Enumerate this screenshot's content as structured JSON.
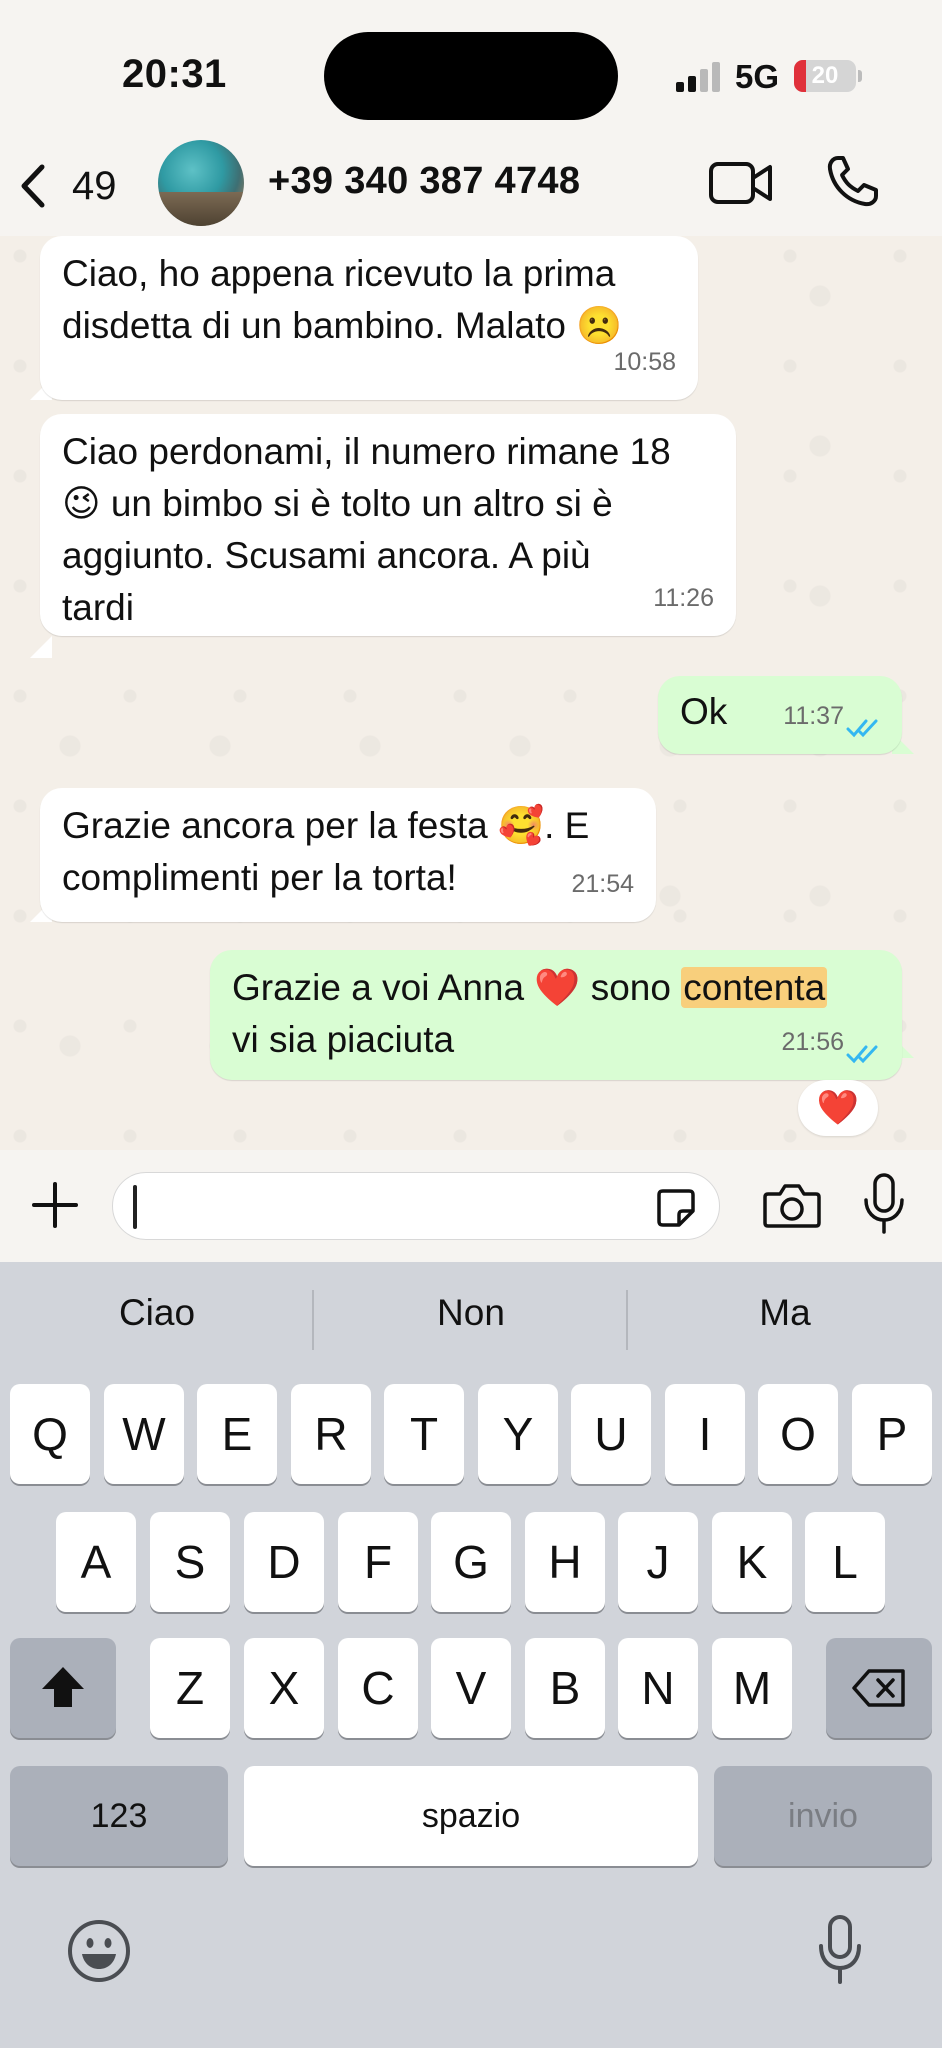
{
  "status": {
    "time": "20:31",
    "network": "5G",
    "battery": "20",
    "battery_level": 0.2,
    "battery_color": "#e0303a"
  },
  "header": {
    "back_count": "49",
    "contact": "+39 340 387 4748"
  },
  "messages": [
    {
      "dir": "in",
      "lines": [
        "Ciao,  ho appena ricevuto la prima",
        "disdetta di un bambino. Malato ☹️"
      ],
      "time": "10:58"
    },
    {
      "dir": "in",
      "lines": [
        "Ciao perdonami, il numero rimane 18",
        "😉 un bimbo si è tolto un altro si è",
        "aggiunto. Scusami ancora. A più",
        "tardi"
      ],
      "time": "11:26"
    },
    {
      "dir": "out",
      "lines": [
        "Ok"
      ],
      "time": "11:37"
    },
    {
      "dir": "in",
      "lines": [
        "Grazie ancora per la festa 🥰. E",
        "complimenti per la torta!"
      ],
      "time": "21:54"
    },
    {
      "dir": "out",
      "line1_a": "Grazie a voi Anna ❤️ sono ",
      "line1_hl": "contenta",
      "line2": "vi sia piaciuta",
      "time": "21:56"
    }
  ],
  "reaction": "❤️",
  "colors": {
    "outgoing_bubble": "#d9fdd3",
    "incoming_bubble": "#ffffff",
    "read_ticks": "#34b7f1",
    "highlight": "#f8cf7c"
  },
  "keyboard": {
    "suggestions": [
      "Ciao",
      "Non",
      "Ma"
    ],
    "row1": [
      "Q",
      "W",
      "E",
      "R",
      "T",
      "Y",
      "U",
      "I",
      "O",
      "P"
    ],
    "row2": [
      "A",
      "S",
      "D",
      "F",
      "G",
      "H",
      "J",
      "K",
      "L"
    ],
    "row3": [
      "Z",
      "X",
      "C",
      "V",
      "B",
      "N",
      "M"
    ],
    "numbers_key": "123",
    "space_key": "spazio",
    "return_key": "invio"
  },
  "icons": {
    "back": "chevron-left-icon",
    "video": "video-camera-icon",
    "call": "phone-icon",
    "attach": "plus-icon",
    "sticker": "sticker-icon",
    "camera": "camera-icon",
    "mic": "microphone-icon",
    "shift": "shift-arrow-icon",
    "delete": "backspace-icon",
    "emoji": "emoji-face-icon"
  }
}
